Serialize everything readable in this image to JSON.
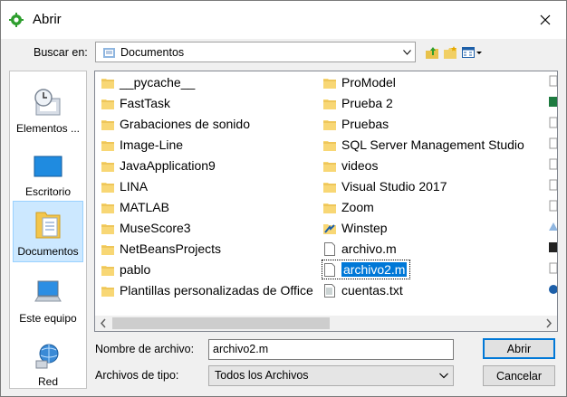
{
  "window": {
    "title": "Abrir"
  },
  "lookin": {
    "label": "Buscar en:",
    "value": "Documentos"
  },
  "places": [
    {
      "label": "Elementos ...",
      "icon": "recent-items-icon"
    },
    {
      "label": "Escritorio",
      "icon": "desktop-icon"
    },
    {
      "label": "Documentos",
      "icon": "documents-icon",
      "selected": true
    },
    {
      "label": "Este equipo",
      "icon": "computer-icon"
    },
    {
      "label": "Red",
      "icon": "network-icon"
    }
  ],
  "files": {
    "col1": [
      {
        "name": "__pycache__",
        "type": "folder"
      },
      {
        "name": "FastTask",
        "type": "folder"
      },
      {
        "name": "Grabaciones de sonido",
        "type": "folder"
      },
      {
        "name": "Image-Line",
        "type": "folder"
      },
      {
        "name": "JavaApplication9",
        "type": "folder"
      },
      {
        "name": "LINA",
        "type": "folder"
      },
      {
        "name": "MATLAB",
        "type": "folder"
      },
      {
        "name": "MuseScore3",
        "type": "folder"
      },
      {
        "name": "NetBeansProjects",
        "type": "folder"
      },
      {
        "name": "pablo",
        "type": "folder"
      },
      {
        "name": "Plantillas personalizadas de Office",
        "type": "folder"
      }
    ],
    "col2": [
      {
        "name": "ProModel",
        "type": "folder"
      },
      {
        "name": "Prueba 2",
        "type": "folder"
      },
      {
        "name": "Pruebas",
        "type": "folder"
      },
      {
        "name": "SQL Server Management Studio",
        "type": "folder"
      },
      {
        "name": "videos",
        "type": "folder"
      },
      {
        "name": "Visual Studio 2017",
        "type": "folder"
      },
      {
        "name": "Zoom",
        "type": "folder"
      },
      {
        "name": "Winstep",
        "type": "special-folder"
      },
      {
        "name": "archivo.m",
        "type": "file"
      },
      {
        "name": "archivo2.m",
        "type": "file",
        "selected": true
      },
      {
        "name": "cuentas.txt",
        "type": "file"
      }
    ]
  },
  "filename": {
    "label": "Nombre de archivo:",
    "value": "archivo2.m"
  },
  "filetype": {
    "label": "Archivos de tipo:",
    "value": "Todos los Archivos"
  },
  "buttons": {
    "open": "Abrir",
    "cancel": "Cancelar"
  },
  "colors": {
    "selection": "#0078d7",
    "folder": "#f8d775",
    "place_selected": "#cce8ff"
  }
}
